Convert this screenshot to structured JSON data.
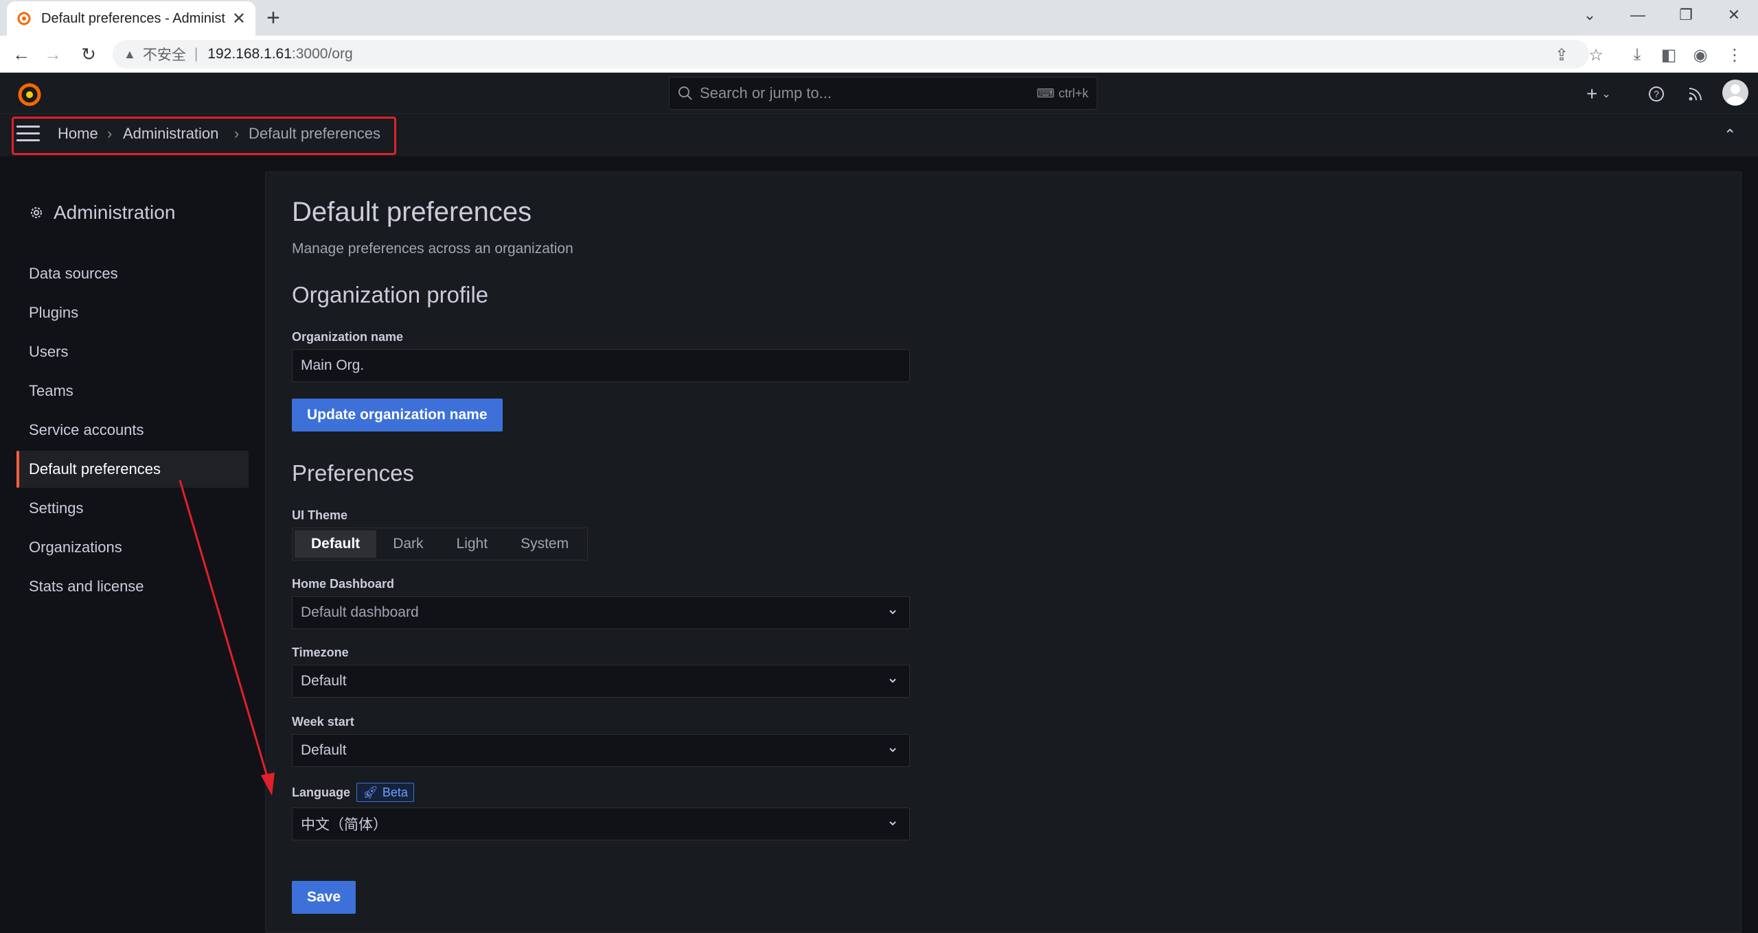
{
  "browser": {
    "tab_title": "Default preferences - Administ",
    "url_warning": "不安全",
    "url_separator": "|",
    "url_host": "192.168.1.61",
    "url_path": ":3000/org"
  },
  "topnav": {
    "search_placeholder": "Search or jump to...",
    "search_shortcut": "ctrl+k"
  },
  "breadcrumb": {
    "items": [
      "Home",
      "Administration",
      "Default preferences"
    ],
    "separator": "›"
  },
  "sidebar": {
    "title": "Administration",
    "items": [
      {
        "label": "Data sources",
        "active": false
      },
      {
        "label": "Plugins",
        "active": false
      },
      {
        "label": "Users",
        "active": false
      },
      {
        "label": "Teams",
        "active": false
      },
      {
        "label": "Service accounts",
        "active": false
      },
      {
        "label": "Default preferences",
        "active": true
      },
      {
        "label": "Settings",
        "active": false
      },
      {
        "label": "Organizations",
        "active": false
      },
      {
        "label": "Stats and license",
        "active": false
      }
    ]
  },
  "page": {
    "title": "Default preferences",
    "subtitle": "Manage preferences across an organization",
    "org_section": "Organization profile",
    "org_name_label": "Organization name",
    "org_name_value": "Main Org.",
    "update_button": "Update organization name",
    "prefs_section": "Preferences",
    "ui_theme_label": "UI Theme",
    "ui_theme_options": [
      "Default",
      "Dark",
      "Light",
      "System"
    ],
    "ui_theme_selected": "Default",
    "home_dashboard_label": "Home Dashboard",
    "home_dashboard_value": "Default dashboard",
    "timezone_label": "Timezone",
    "timezone_value": "Default",
    "week_start_label": "Week start",
    "week_start_value": "Default",
    "language_label": "Language",
    "language_badge": "Beta",
    "language_value": "中文（简体）",
    "save_button": "Save"
  },
  "colors": {
    "accent_primary": "#3d71d9",
    "active_indicator": "#f55f3e",
    "annotation_red": "#e0202a"
  }
}
